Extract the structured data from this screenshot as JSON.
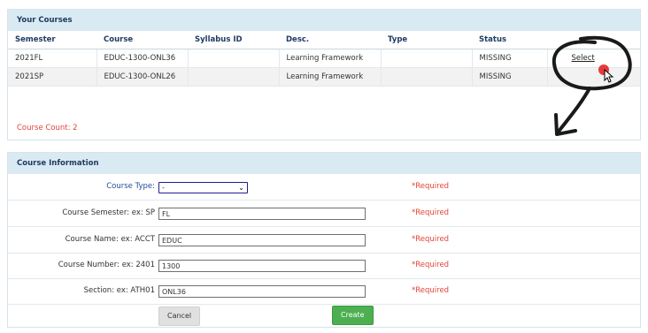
{
  "courses_panel": {
    "title": "Your Courses",
    "columns": [
      "Semester",
      "Course",
      "Syllabus ID",
      "Desc.",
      "Type",
      "Status"
    ],
    "rows": [
      {
        "semester": "2021FL",
        "course": "EDUC-1300-ONL36",
        "syllabus_id": "",
        "desc": "Learning Framework",
        "type": "",
        "status": "MISSING",
        "action": "Select"
      },
      {
        "semester": "2021SP",
        "course": "EDUC-1300-ONL26",
        "syllabus_id": "",
        "desc": "Learning Framework",
        "type": "",
        "status": "MISSING",
        "action": ""
      }
    ],
    "course_count": "Course Count: 2"
  },
  "course_info": {
    "title": "Course Information",
    "course_type": {
      "label": "Course Type:",
      "value": "-"
    },
    "fields": [
      {
        "label": "Course Semester:  ex: SP",
        "value": "FL"
      },
      {
        "label": "Course Name:  ex: ACCT",
        "value": "EDUC"
      },
      {
        "label": "Course Number:  ex: 2401",
        "value": "1300"
      },
      {
        "label": "Section:  ex: ATH01",
        "value": "ONL36"
      }
    ],
    "required": "*Required",
    "cancel_label": "Cancel",
    "create_label": "Create"
  }
}
